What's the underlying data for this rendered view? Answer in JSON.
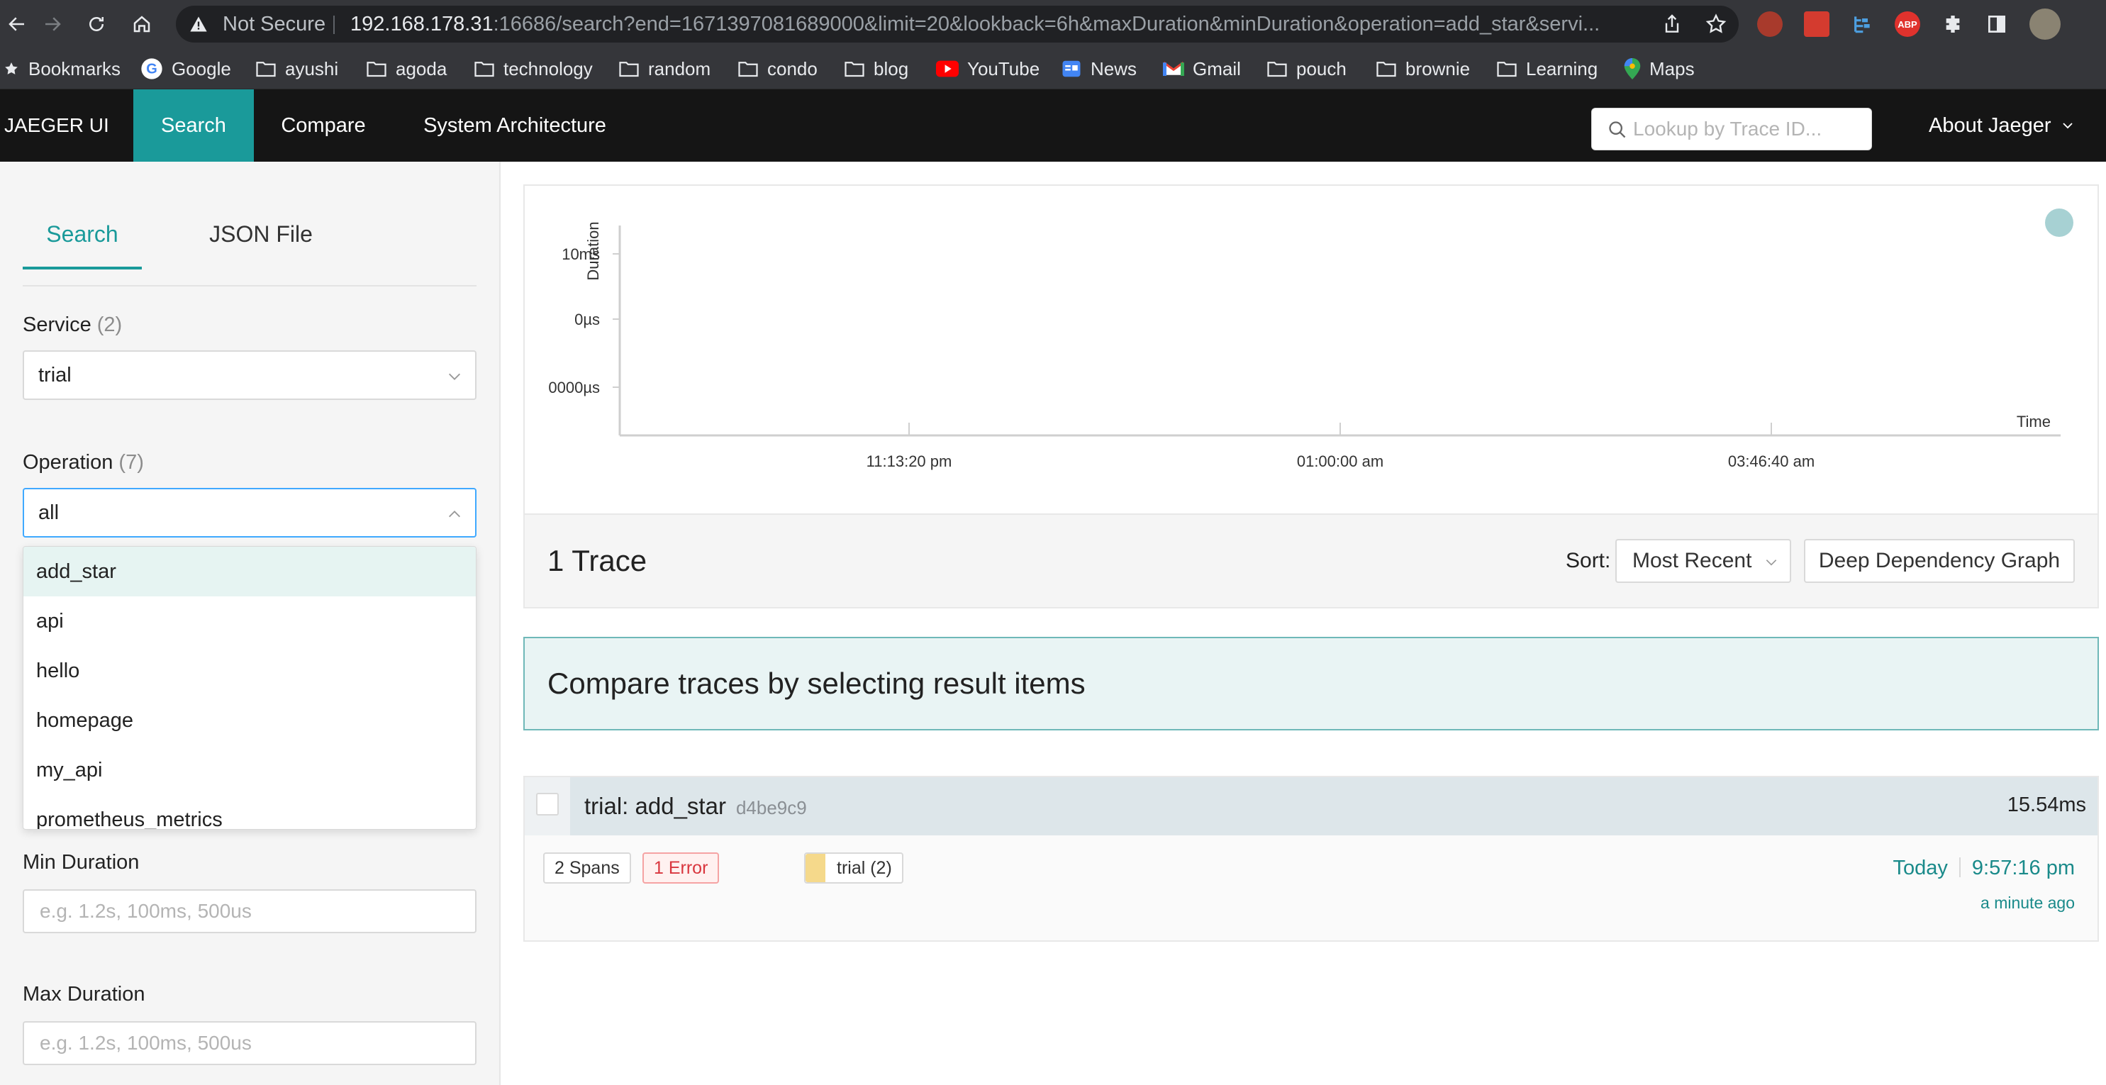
{
  "browser": {
    "security_label": "Not Secure",
    "url_host": "192.168.178.31",
    "url_rest": ":16686/search?end=1671397081689000&limit=20&lookback=6h&maxDuration&minDuration&operation=add_star&servi...",
    "bookmarks": [
      {
        "label": "Bookmarks",
        "icon": "star-icon"
      },
      {
        "label": "Google",
        "icon": "google-icon"
      },
      {
        "label": "ayushi",
        "icon": "folder-icon"
      },
      {
        "label": "agoda",
        "icon": "folder-icon"
      },
      {
        "label": "technology",
        "icon": "folder-icon"
      },
      {
        "label": "random",
        "icon": "folder-icon"
      },
      {
        "label": "condo",
        "icon": "folder-icon"
      },
      {
        "label": "blog",
        "icon": "folder-icon"
      },
      {
        "label": "YouTube",
        "icon": "youtube-icon"
      },
      {
        "label": "News",
        "icon": "news-icon"
      },
      {
        "label": "Gmail",
        "icon": "gmail-icon"
      },
      {
        "label": "pouch",
        "icon": "folder-icon"
      },
      {
        "label": "brownie",
        "icon": "folder-icon"
      },
      {
        "label": "Learning",
        "icon": "folder-icon"
      },
      {
        "label": "Maps",
        "icon": "maps-icon"
      }
    ],
    "extension_abp": "ABP"
  },
  "topnav": {
    "brand": "JAEGER UI",
    "tabs": [
      "Search",
      "Compare",
      "System Architecture"
    ],
    "active_tab": "Search",
    "lookup_placeholder": "Lookup by Trace ID...",
    "about": "About Jaeger"
  },
  "search_panel": {
    "tabs": [
      "Search",
      "JSON File"
    ],
    "service_label": "Service",
    "service_count": "(2)",
    "service_value": "trial",
    "operation_label": "Operation",
    "operation_count": "(7)",
    "operation_value": "all",
    "operation_options": [
      "add_star",
      "api",
      "hello",
      "homepage",
      "my_api",
      "prometheus_metrics"
    ],
    "min_duration_label": "Min Duration",
    "min_duration_placeholder": "e.g. 1.2s, 100ms, 500us",
    "max_duration_label": "Max Duration",
    "max_duration_placeholder": "e.g. 1.2s, 100ms, 500us"
  },
  "chart_data": {
    "type": "scatter",
    "title": "",
    "xlabel": "Time",
    "ylabel": "Duration",
    "x_ticks": [
      "11:13:20 pm",
      "01:00:00 am",
      "03:46:40 am"
    ],
    "y_ticks": [
      "10ms",
      "0µs",
      "0000µs"
    ],
    "points": [
      {
        "x": "9:57:16 pm",
        "y": "15.54ms",
        "color": "#a7d1d3"
      }
    ]
  },
  "results": {
    "count_title": "1 Trace",
    "sort_label": "Sort:",
    "sort_value": "Most Recent",
    "ddg_button": "Deep Dependency Graph",
    "compare_banner": "Compare traces by selecting result items",
    "trace": {
      "name": "trial: add_star",
      "id": "d4be9c9",
      "duration": "15.54ms",
      "spans": "2 Spans",
      "errors": "1 Error",
      "service_tag": "trial (2)",
      "service_color": "#f5d98b",
      "date": "Today",
      "time": "9:57:16 pm",
      "ago": "a minute ago"
    }
  }
}
